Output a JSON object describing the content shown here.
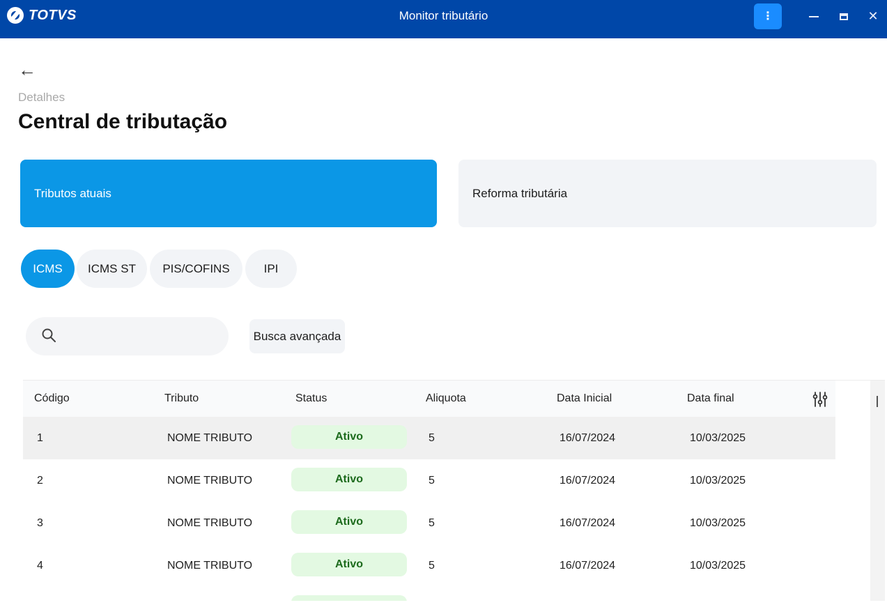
{
  "titlebar": {
    "brand": "TOTVS",
    "title": "Monitor tributário",
    "menu_icon": "kebab-menu-icon",
    "menu_glyph": "⋮",
    "close_glyph": "✕"
  },
  "header": {
    "back_glyph": "←",
    "breadcrumb": "Detalhes",
    "title": "Central de tributação"
  },
  "cards": [
    {
      "label": "Tributos atuais",
      "selected": true
    },
    {
      "label": "Reforma tributária",
      "selected": false
    }
  ],
  "tabs": [
    {
      "label": "ICMS",
      "selected": true
    },
    {
      "label": "ICMS ST",
      "selected": false
    },
    {
      "label": "PIS/COFINS",
      "selected": false
    },
    {
      "label": "IPI",
      "selected": false
    }
  ],
  "search": {
    "placeholder": "",
    "value": "",
    "advanced_label": "Busca avançada"
  },
  "table": {
    "columns": [
      "Código",
      "Tributo",
      "Status",
      "Aliquota",
      "Data Inicial",
      "Data final"
    ],
    "rows": [
      {
        "codigo": "1",
        "tributo": "NOME TRIBUTO",
        "status": "Ativo",
        "aliquota": "5",
        "data_inicial": "16/07/2024",
        "data_final": "10/03/2025"
      },
      {
        "codigo": "2",
        "tributo": "NOME TRIBUTO",
        "status": "Ativo",
        "aliquota": "5",
        "data_inicial": "16/07/2024",
        "data_final": "10/03/2025"
      },
      {
        "codigo": "3",
        "tributo": "NOME TRIBUTO",
        "status": "Ativo",
        "aliquota": "5",
        "data_inicial": "16/07/2024",
        "data_final": "10/03/2025"
      },
      {
        "codigo": "4",
        "tributo": "NOME TRIBUTO",
        "status": "Ativo",
        "aliquota": "5",
        "data_inicial": "16/07/2024",
        "data_final": "10/03/2025"
      }
    ]
  },
  "colors": {
    "titlebar": "#0047a8",
    "accent": "#0b97e6",
    "status_bg": "#e3f9e2",
    "status_text": "#1d6b1d"
  }
}
